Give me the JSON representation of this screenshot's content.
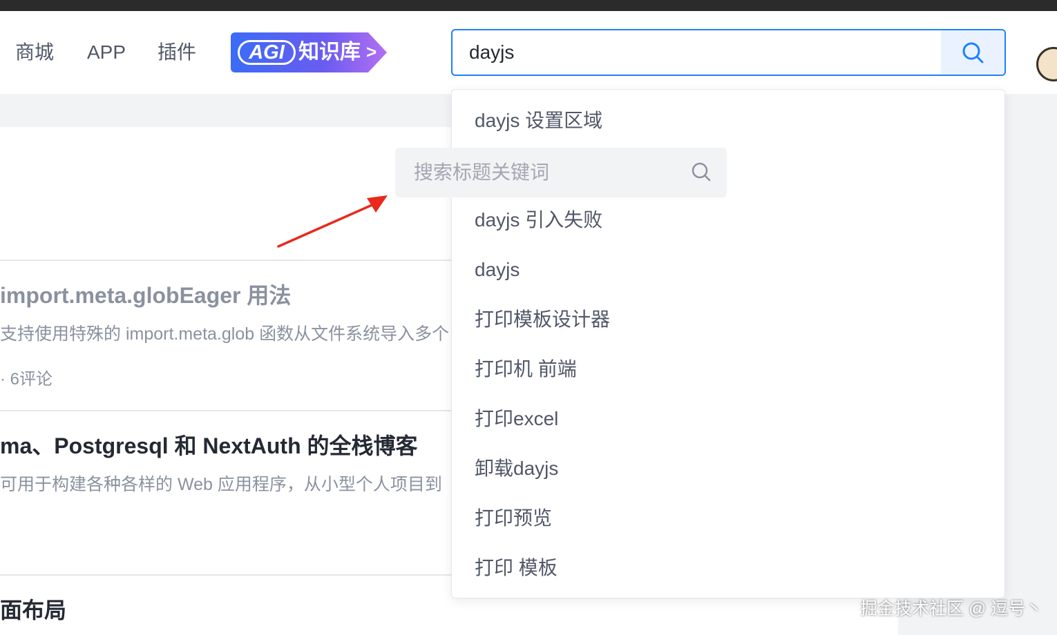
{
  "header": {
    "nav": [
      "商城",
      "APP",
      "插件"
    ],
    "agi_badge": {
      "pill": "AGI",
      "text": "知识库",
      "arrow": ">"
    },
    "search": {
      "value": "dayjs",
      "button_icon": "search-icon"
    },
    "avatar_icon": "user-avatar-icon"
  },
  "articles": [
    {
      "title": " import.meta.globEager 用法",
      "abstract": "支持使用特殊的 import.meta.glob 函数从文件系统导入多个",
      "meta": "· 6评论"
    },
    {
      "title": "ma、Postgresql 和 NextAuth 的全栈博客",
      "abstract": "可用于构建各种各样的 Web 应用程序，从小型个人项目到"
    },
    {
      "title": "面布局"
    }
  ],
  "dropdown": {
    "items": [
      "dayjs 设置区域",
      "dayjs 引入失败",
      "dayjs",
      "打印模板设计器",
      "打印机 前端",
      "打印excel",
      "卸载dayjs",
      "打印预览",
      "打印 模板"
    ]
  },
  "floating_search": {
    "placeholder": "搜索标题关键词",
    "icon": "search-icon"
  },
  "annotation": {
    "color": "#e8291c"
  },
  "watermark": "掘金技术社区 @ 逗号丶",
  "colors": {
    "accent": "#1e80ff",
    "text": "#252933",
    "muted": "#8a919f",
    "bg": "#f2f3f5"
  }
}
